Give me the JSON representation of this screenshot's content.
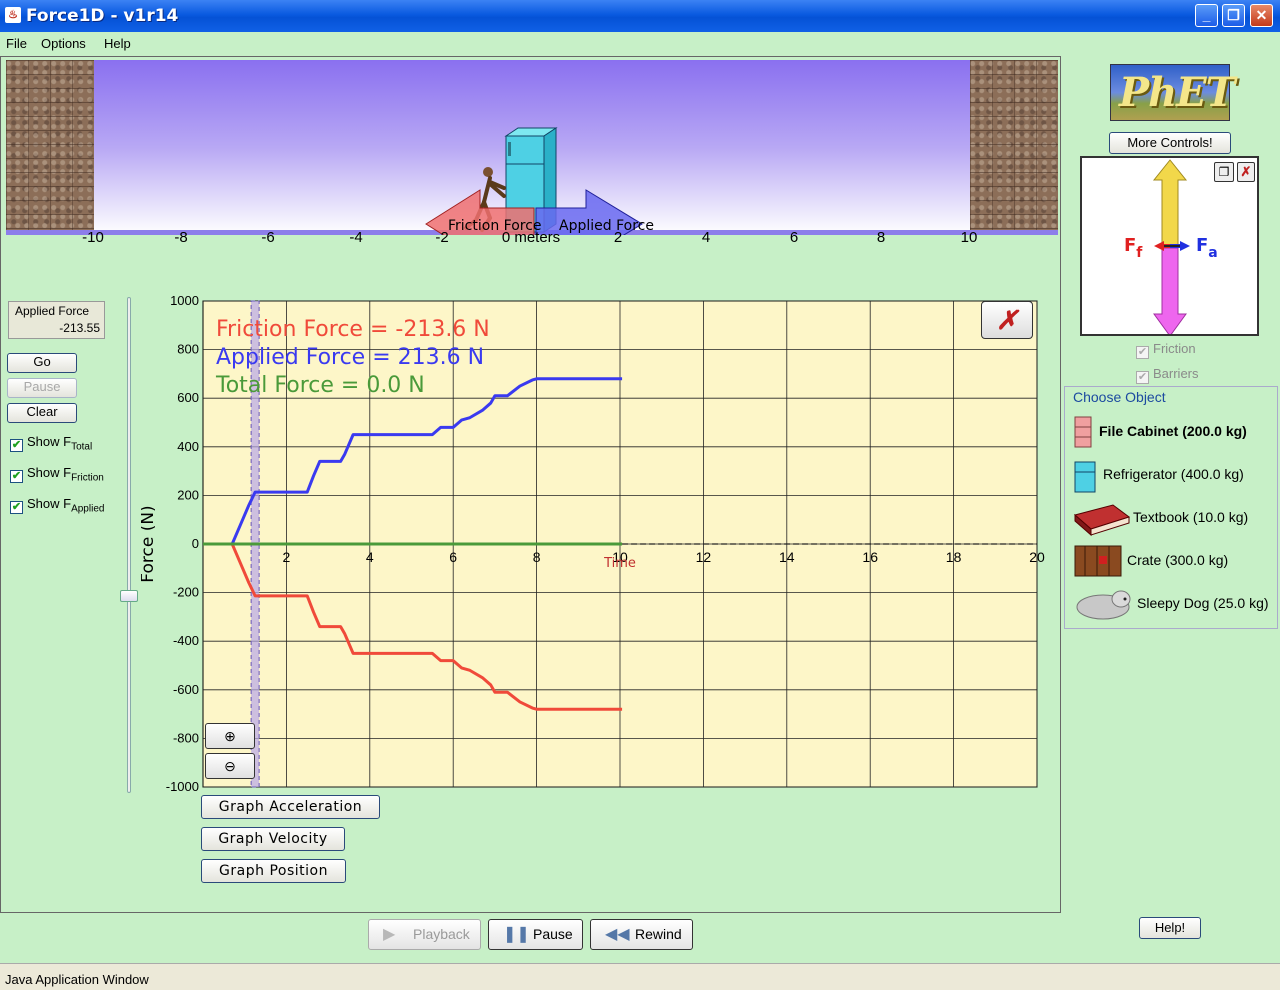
{
  "window": {
    "title": "Force1D - v1r14",
    "min": "_",
    "max": "❐",
    "close": "✕"
  },
  "menu": [
    "File",
    "Options",
    "Help"
  ],
  "scene": {
    "axis_labels": [
      "-10",
      "-8",
      "-6",
      "-4",
      "-2",
      "0 meters",
      "2",
      "4",
      "6",
      "8",
      "10"
    ],
    "friction_arrow_label": "Friction Force",
    "applied_arrow_label": "Applied Force"
  },
  "controls": {
    "applied_force_label": "Applied Force",
    "applied_force_value": "-213.55",
    "go": "Go",
    "pause": "Pause",
    "clear": "Clear",
    "show_total": {
      "prefix": "Show F",
      "sub": "Total",
      "checked": true
    },
    "show_friction": {
      "prefix": "Show F",
      "sub": "Friction",
      "checked": true
    },
    "show_applied": {
      "prefix": "Show F",
      "sub": "Applied",
      "checked": true
    }
  },
  "readouts": {
    "friction": "Friction Force =  -213.6 N",
    "applied": "Applied Force =  213.6 N",
    "total": "Total Force =  0.0 N"
  },
  "graph_buttons": {
    "acceleration": "Graph Acceleration",
    "velocity": "Graph Velocity",
    "position": "Graph Position"
  },
  "playback": {
    "playback": "Playback",
    "pause": "Pause",
    "rewind": "Rewind"
  },
  "status": "Java Application Window",
  "right": {
    "logo": "PhET",
    "more_controls": "More Controls!",
    "friction": "Friction",
    "barriers": "Barriers",
    "choose_object": "Choose Object",
    "objects": [
      {
        "label": "File Cabinet (200.0 kg)",
        "selected": true
      },
      {
        "label": "Refrigerator (400.0 kg)",
        "selected": false
      },
      {
        "label": "Textbook (10.0 kg)",
        "selected": false
      },
      {
        "label": "Crate (300.0 kg)",
        "selected": false
      },
      {
        "label": "Sleepy Dog (25.0 kg)",
        "selected": false
      }
    ],
    "help": "Help!",
    "fbd_ff": "F",
    "fbd_ff_sub": "f",
    "fbd_fa": "F",
    "fbd_fa_sub": "a"
  },
  "colors": {
    "friction": "#f04a3a",
    "applied": "#3a3af0",
    "total": "#4a9a3a",
    "graph_bg": "#fdf6c8"
  },
  "chart_data": {
    "type": "line",
    "xlabel": "Time",
    "ylabel": "Force (N)",
    "xlim": [
      0,
      20
    ],
    "ylim": [
      -1000,
      1000
    ],
    "xticks": [
      2,
      4,
      6,
      8,
      10,
      12,
      14,
      16,
      18,
      20
    ],
    "yticks": [
      1000,
      800,
      600,
      400,
      200,
      0,
      -200,
      -400,
      -600,
      -800,
      -1000
    ],
    "cursor_x": 1.25,
    "series": [
      {
        "name": "Applied Force",
        "color": "#3a3af0",
        "x": [
          0,
          0.7,
          0.9,
          1.1,
          1.25,
          2.5,
          2.65,
          2.8,
          3.3,
          3.4,
          3.6,
          5.5,
          5.7,
          6.0,
          6.2,
          6.4,
          6.7,
          6.9,
          7.0,
          7.3,
          7.6,
          7.9,
          8.0,
          10.05
        ],
        "y": [
          0,
          0,
          80,
          160,
          213.6,
          213.6,
          280,
          340,
          340,
          370,
          450,
          450,
          480,
          480,
          510,
          520,
          550,
          580,
          610,
          610,
          650,
          675,
          680,
          680
        ]
      },
      {
        "name": "Friction Force",
        "color": "#f04a3a",
        "x": [
          0,
          0.7,
          0.9,
          1.1,
          1.25,
          2.5,
          2.65,
          2.8,
          3.3,
          3.4,
          3.6,
          5.5,
          5.7,
          6.0,
          6.2,
          6.4,
          6.7,
          6.9,
          7.0,
          7.3,
          7.6,
          7.9,
          8.0,
          10.05
        ],
        "y": [
          0,
          0,
          -80,
          -160,
          -213.6,
          -213.6,
          -280,
          -340,
          -340,
          -370,
          -450,
          -450,
          -480,
          -480,
          -510,
          -520,
          -550,
          -580,
          -610,
          -610,
          -650,
          -675,
          -680,
          -680
        ]
      },
      {
        "name": "Total Force",
        "color": "#4a9a3a",
        "x": [
          0,
          10.05
        ],
        "y": [
          0,
          0
        ]
      }
    ]
  }
}
